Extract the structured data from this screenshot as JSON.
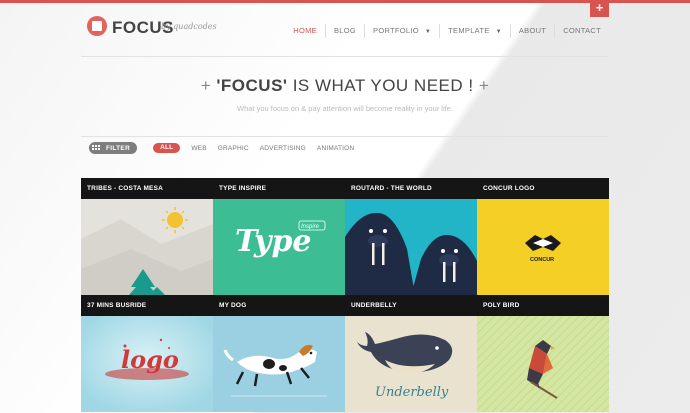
{
  "brand": {
    "name": "FOCUS",
    "byline": "by quadcodes"
  },
  "nav": {
    "home": "HOME",
    "blog": "BLOG",
    "portfolio": "PORTFOLIO",
    "template": "TEMPLATE",
    "about": "ABOUT",
    "contact": "CONTACT"
  },
  "plus_tab": "+",
  "hero": {
    "plus_left": "+",
    "title_strong": "'FOCUS'",
    "title_rest": " IS WHAT YOU NEED !",
    "plus_right": "+",
    "subtitle": "What you focus on & pay attention will become reality in your life."
  },
  "filter": {
    "button": "FILTER",
    "options": [
      "ALL",
      "WEB",
      "GRAPHIC",
      "ADVERTISING",
      "ANIMATION"
    ]
  },
  "portfolio": {
    "items": [
      {
        "title": "TRIBES - COSTA MESA"
      },
      {
        "title": "TYPE INSPIRE",
        "art_text": "Type",
        "art_badge": "Inspire"
      },
      {
        "title": "ROUTARD - THE WORLD"
      },
      {
        "title": "CONCUR LOGO",
        "art_text": "CONCUR"
      },
      {
        "title": "37 MINS BUSRIDE",
        "art_text": "logo"
      },
      {
        "title": "MY DOG"
      },
      {
        "title": "UNDERBELLY",
        "art_text": "Underbelly"
      },
      {
        "title": "POLY BIRD"
      }
    ]
  },
  "colors": {
    "accent": "#d9534f",
    "tile_bar": "#151515",
    "tribes_bg": "#e3e2dd",
    "type_bg": "#3dbd93",
    "routard_bg": "#22b4c7",
    "concur_bg": "#f4cf25",
    "busride_bg": "#a5dde8",
    "dog_bg": "#9bd0e3",
    "underbelly_bg": "#e8e2cf",
    "polybird_bg": "#d2e5a0"
  }
}
